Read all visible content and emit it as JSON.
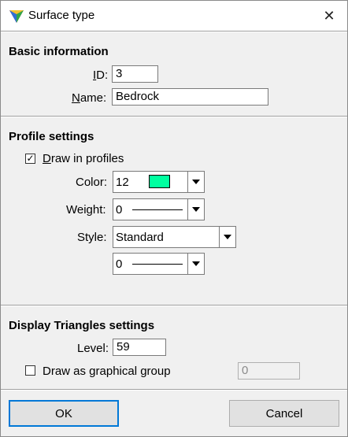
{
  "window": {
    "title": "Surface type",
    "close_glyph": "✕"
  },
  "basic": {
    "heading": "Basic information",
    "id_label_u": "I",
    "id_label_rest": "D:",
    "id_value": "3",
    "name_label_u": "N",
    "name_label_rest": "ame:",
    "name_value": "Bedrock"
  },
  "profile": {
    "heading": "Profile settings",
    "draw_checked": "✓",
    "draw_label_u": "D",
    "draw_label_rest": "raw in profiles",
    "color_label": "Color:",
    "color_value": "12",
    "color_swatch": "#00ffa0",
    "weight_label": "Weight:",
    "weight_value": "0",
    "style_label": "Style:",
    "style_value": "Standard",
    "style_level_value": "0"
  },
  "triangles": {
    "heading": "Display Triangles settings",
    "level_label": "Level:",
    "level_value": "59",
    "group_label": "Draw as graphical group",
    "group_value": "0"
  },
  "buttons": {
    "ok": "OK",
    "cancel": "Cancel"
  }
}
